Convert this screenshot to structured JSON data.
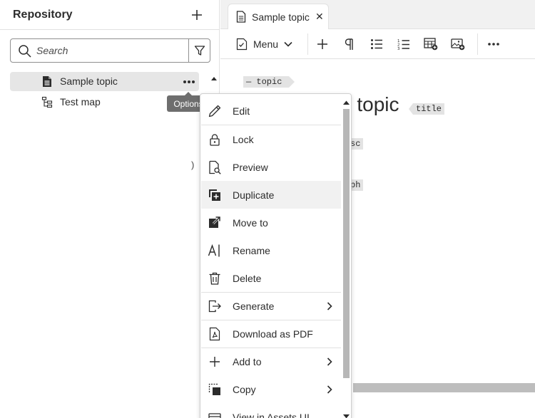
{
  "repository": {
    "title": "Repository",
    "search": {
      "placeholder": "Search",
      "value": ""
    },
    "items": [
      {
        "label": "Sample topic",
        "icon": "document-icon",
        "selected": true
      },
      {
        "label": "Test map",
        "icon": "map-icon",
        "selected": false
      }
    ],
    "tooltip": "Options",
    "partial_glyph": ")"
  },
  "editor": {
    "tab": {
      "label": "Sample topic",
      "close": "✕"
    },
    "toolbar": {
      "menu_label": "Menu"
    },
    "document": {
      "topic_tag": "— topic",
      "title_text": "e topic",
      "title_tag": "title",
      "shortdesc_fragment": "sc",
      "paragraph_fragment": "ph"
    }
  },
  "context_menu": {
    "items": [
      {
        "label": "Edit",
        "icon": "pencil-icon",
        "submenu": false
      },
      {
        "label": "Lock",
        "icon": "lock-icon",
        "submenu": false
      },
      {
        "label": "Preview",
        "icon": "preview-icon",
        "submenu": false
      },
      {
        "label": "Duplicate",
        "icon": "duplicate-icon",
        "submenu": false
      },
      {
        "label": "Move to",
        "icon": "move-icon",
        "submenu": false
      },
      {
        "label": "Rename",
        "icon": "rename-icon",
        "submenu": false
      },
      {
        "label": "Delete",
        "icon": "trash-icon",
        "submenu": false
      },
      {
        "label": "Generate",
        "icon": "export-icon",
        "submenu": true
      },
      {
        "label": "Download as PDF",
        "icon": "pdf-icon",
        "submenu": false
      },
      {
        "label": "Add to",
        "icon": "plus-icon",
        "submenu": true
      },
      {
        "label": "Copy",
        "icon": "copy-icon",
        "submenu": true
      },
      {
        "label": "View in Assets UI",
        "icon": "assets-icon",
        "submenu": false
      }
    ]
  },
  "colors": {
    "selected_row": "#e6e6e6",
    "tooltip_bg": "#6e6e6e",
    "tag_bg": "#e3e3e3",
    "menu_hover": "#f1f1f1"
  }
}
